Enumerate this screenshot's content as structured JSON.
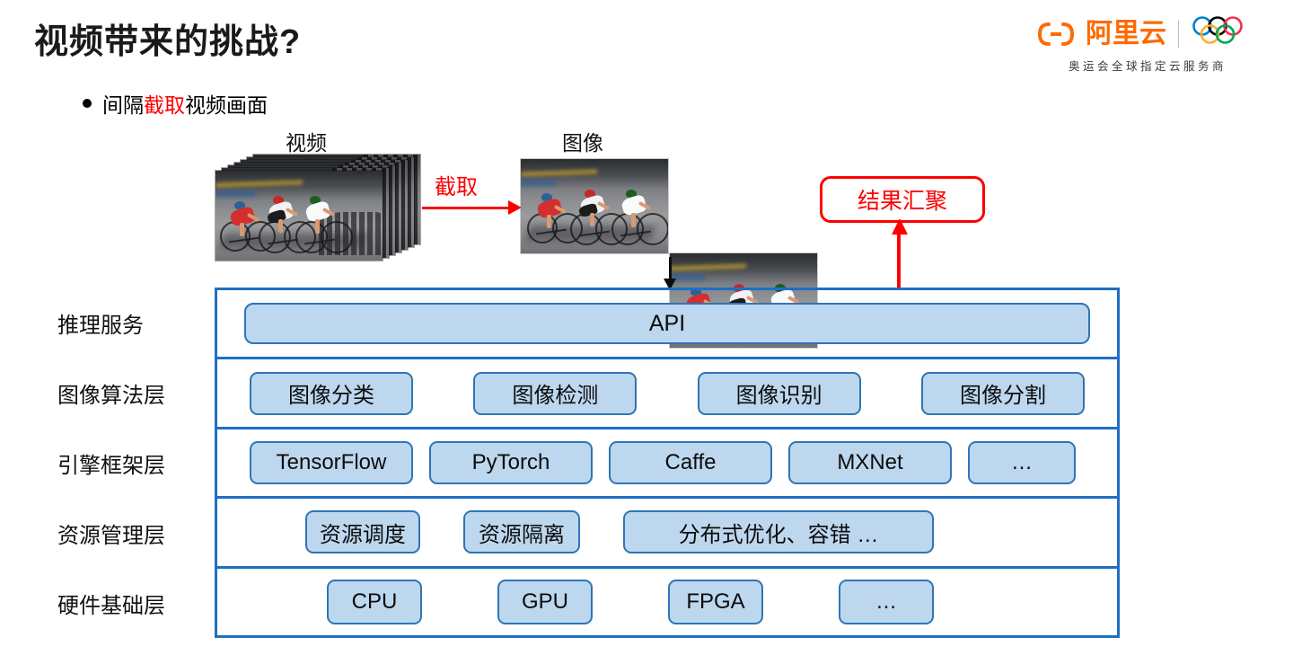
{
  "slide": {
    "title": "视频带来的挑战?",
    "bullet": {
      "prefix": "间隔",
      "highlight": "截取",
      "suffix": "视频画面"
    }
  },
  "brand": {
    "name": "阿里云",
    "tagline": "奥运会全球指定云服务商",
    "accent_color": "#ff6a00",
    "olympic_ring_colors": [
      "#0081c8",
      "#000000",
      "#ee334e",
      "#fcb131",
      "#00a651"
    ]
  },
  "flow": {
    "video_caption": "视频",
    "image_caption": "图像",
    "cut_label": "截取",
    "aggregate_label": "结果汇聚",
    "red_color": "#fe0000",
    "frame_count": 2
  },
  "stack": {
    "border_color": "#1f6fc4",
    "chip_fill": "#bdd7ee",
    "chip_border": "#2e75b6",
    "layers": [
      {
        "label": "推理服务",
        "items": [
          "API"
        ]
      },
      {
        "label": "图像算法层",
        "items": [
          "图像分类",
          "图像检测",
          "图像识别",
          "图像分割"
        ]
      },
      {
        "label": "引擎框架层",
        "items": [
          "TensorFlow",
          "PyTorch",
          "Caffe",
          "MXNet",
          "…"
        ]
      },
      {
        "label": "资源管理层",
        "items": [
          "资源调度",
          "资源隔离",
          "分布式优化、容错 …"
        ]
      },
      {
        "label": "硬件基础层",
        "items": [
          "CPU",
          "GPU",
          "FPGA",
          "…"
        ]
      }
    ]
  }
}
